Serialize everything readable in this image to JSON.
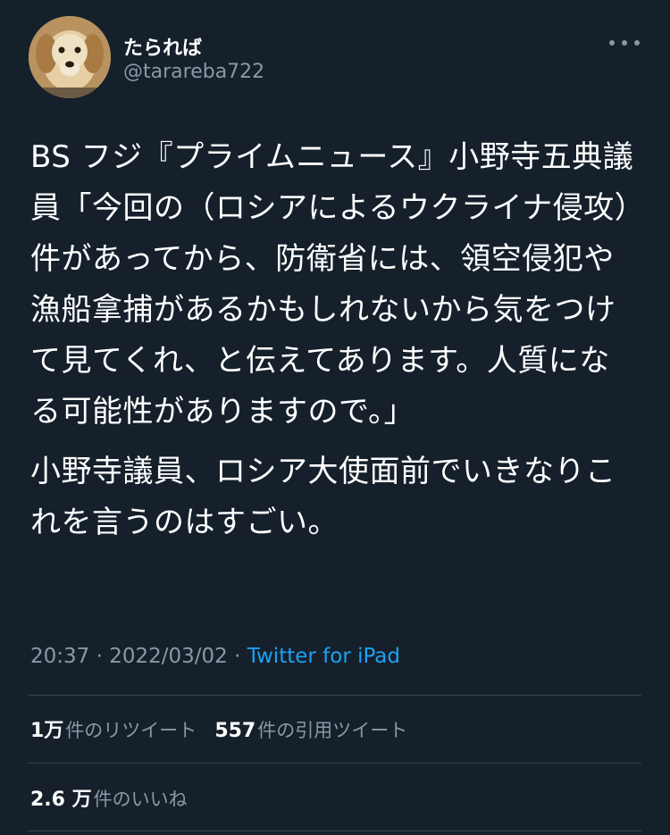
{
  "author": {
    "display_name": "たられば",
    "handle": "@tarareba722"
  },
  "tweet": {
    "paragraphs": [
      "BS フジ『プライムニュース』小野寺五典議員「今回の（ロシアによるウクライナ侵攻）件があってから、防衛省には、領空侵犯や漁船拿捕があるかもしれないから気をつけて見てくれ、と伝えてあります。人質になる可能性がありますので。」",
      "小野寺議員、ロシア大使面前でいきなりこれを言うのはすごい。"
    ],
    "time": "20:37",
    "separator": "·",
    "date": "2022/03/02",
    "source": "Twitter for iPad"
  },
  "stats": {
    "retweets": {
      "count": "1万",
      "label": "件のリツイート"
    },
    "quotes": {
      "count": "557",
      "label": "件の引用ツイート"
    },
    "likes": {
      "count": "2.6 万",
      "label": "件のいいね"
    }
  },
  "icons": {
    "avatar": "golden-retriever-photo",
    "more": "more-horizontal-icon"
  },
  "colors": {
    "background": "#15202b",
    "text": "#ffffff",
    "secondary": "#8899a6",
    "link": "#1da1f2",
    "divider": "#38444d"
  }
}
